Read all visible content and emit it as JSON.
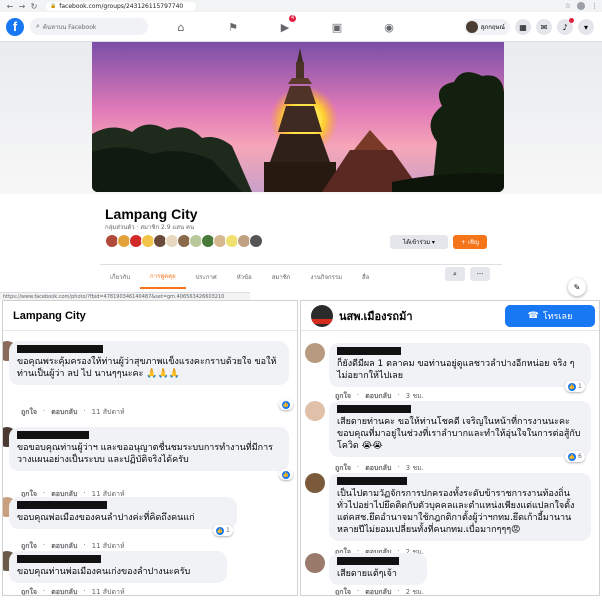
{
  "browser": {
    "url": "facebook.com/groups/243126115797740",
    "status_link": "https://www.facebook.com/photo/?fbid=478190346140487&set=gm.406563426603210"
  },
  "fb": {
    "logo": "f",
    "search_placeholder": "ค้นหาบน Facebook",
    "notification_count": "4",
    "profile_name": "สุภกฤษณ์",
    "brand_color": "#1877f2"
  },
  "group": {
    "name": "Lampang City",
    "meta": "กลุ่มส่วนตัว · สมาชิก 2.9 แสน คน",
    "joined_label": "ได้เข้าร่วม ▾",
    "invite_label": "+ เชิญ",
    "accent_color": "#f5761a",
    "tabs": [
      "เกี่ยวกับ",
      "การพูดคุย",
      "ประกาศ",
      "หัวข้อ",
      "สมาชิก",
      "งานกิจกรรม",
      "สื่อ"
    ],
    "more_label": "···"
  },
  "left_panel": {
    "title": "Lampang City",
    "comments": [
      {
        "text": "ขอคุณพระคุ้มครองให้ท่านผู้ว่าสุขภาพแข็งแรงคะกราบด้วยใจ ขอให้ท่านเป็นผู้ว่า ลป ไป นานๆๆนะคะ 🙏🙏🙏",
        "like": "ถูกใจ",
        "reply": "ตอบกลับ",
        "time": "11 สัปดาห์"
      },
      {
        "text": "ขอขอบคุณท่านผู้ว่าฯ และขออนุญาตชื่นชมระบบการทำงานที่มีการวางแผนอย่างเป็นระบบ และปฏิบัติจริงได้ครับ",
        "like": "ถูกใจ",
        "reply": "ตอบกลับ",
        "time": "11 สัปดาห์"
      },
      {
        "text": "ขอบคุณพ่อเมืองของคนลำปางค่ะที่คิดถึงคนแก่",
        "like": "ถูกใจ",
        "reply": "ตอบกลับ",
        "time": "11 สัปดาห์",
        "reactions": "1"
      },
      {
        "text": "ขอบคุณท่านพ่อเมืองคนเก่งของลำปางนะครับ",
        "like": "ถูกใจ",
        "reply": "ตอบกลับ",
        "time": "11 สัปดาห์"
      }
    ]
  },
  "right_panel": {
    "title": "นสพ.เมืองรถม้า",
    "call_label": "โทรเลย",
    "call_icon": "phone-icon",
    "comments": [
      {
        "text": "ก็ยังดีมีผล 1 ตลาคม ขอท่านอยู่ดูแลชาวลำปางอีกหน่อย จริง ๆ ไม่อยากให้ไปเลย",
        "like": "ถูกใจ",
        "reply": "ตอบกลับ",
        "time": "3 ชม.",
        "reactions": "1"
      },
      {
        "text": "เสียดายท่านคะ ขอให้ท่านโชคดี เจริญในหน้าที่การงานนะคะ ขอบคุณที่มาอยู่ในช่วงที่เราลำบากและทำให้อุ่นใจในการต่อสู้กับโควิด 😭😭",
        "like": "ถูกใจ",
        "reply": "ตอบกลับ",
        "time": "3 ชม.",
        "reactions": "6"
      },
      {
        "text": "เป็นไปตามวัฏจักรการปกครองทั้งระดับข้าราชการงานท้องถิ่นทั่วไปอย่าไปยึดติดกับตัวบุคคลและตำแหน่งเพียงแต่แปลกใจตั้งแต่คสช.ยึดอำนาจมาใช้กฎกติกาตั้งผู้ว่าฯกทม.ยึดเก้าอี้มานานหลายปีไม่ยอมเปลี่ยนทั้งที่คนกทม.เบื่อมากๆๆๆ😡",
        "like": "ถูกใจ",
        "reply": "ตอบกลับ",
        "time": "2 ชม."
      },
      {
        "text": "เสียดายแต้ๆเจ้า",
        "like": "ถูกใจ",
        "reply": "ตอบกลับ",
        "time": "2 ชม."
      }
    ]
  }
}
